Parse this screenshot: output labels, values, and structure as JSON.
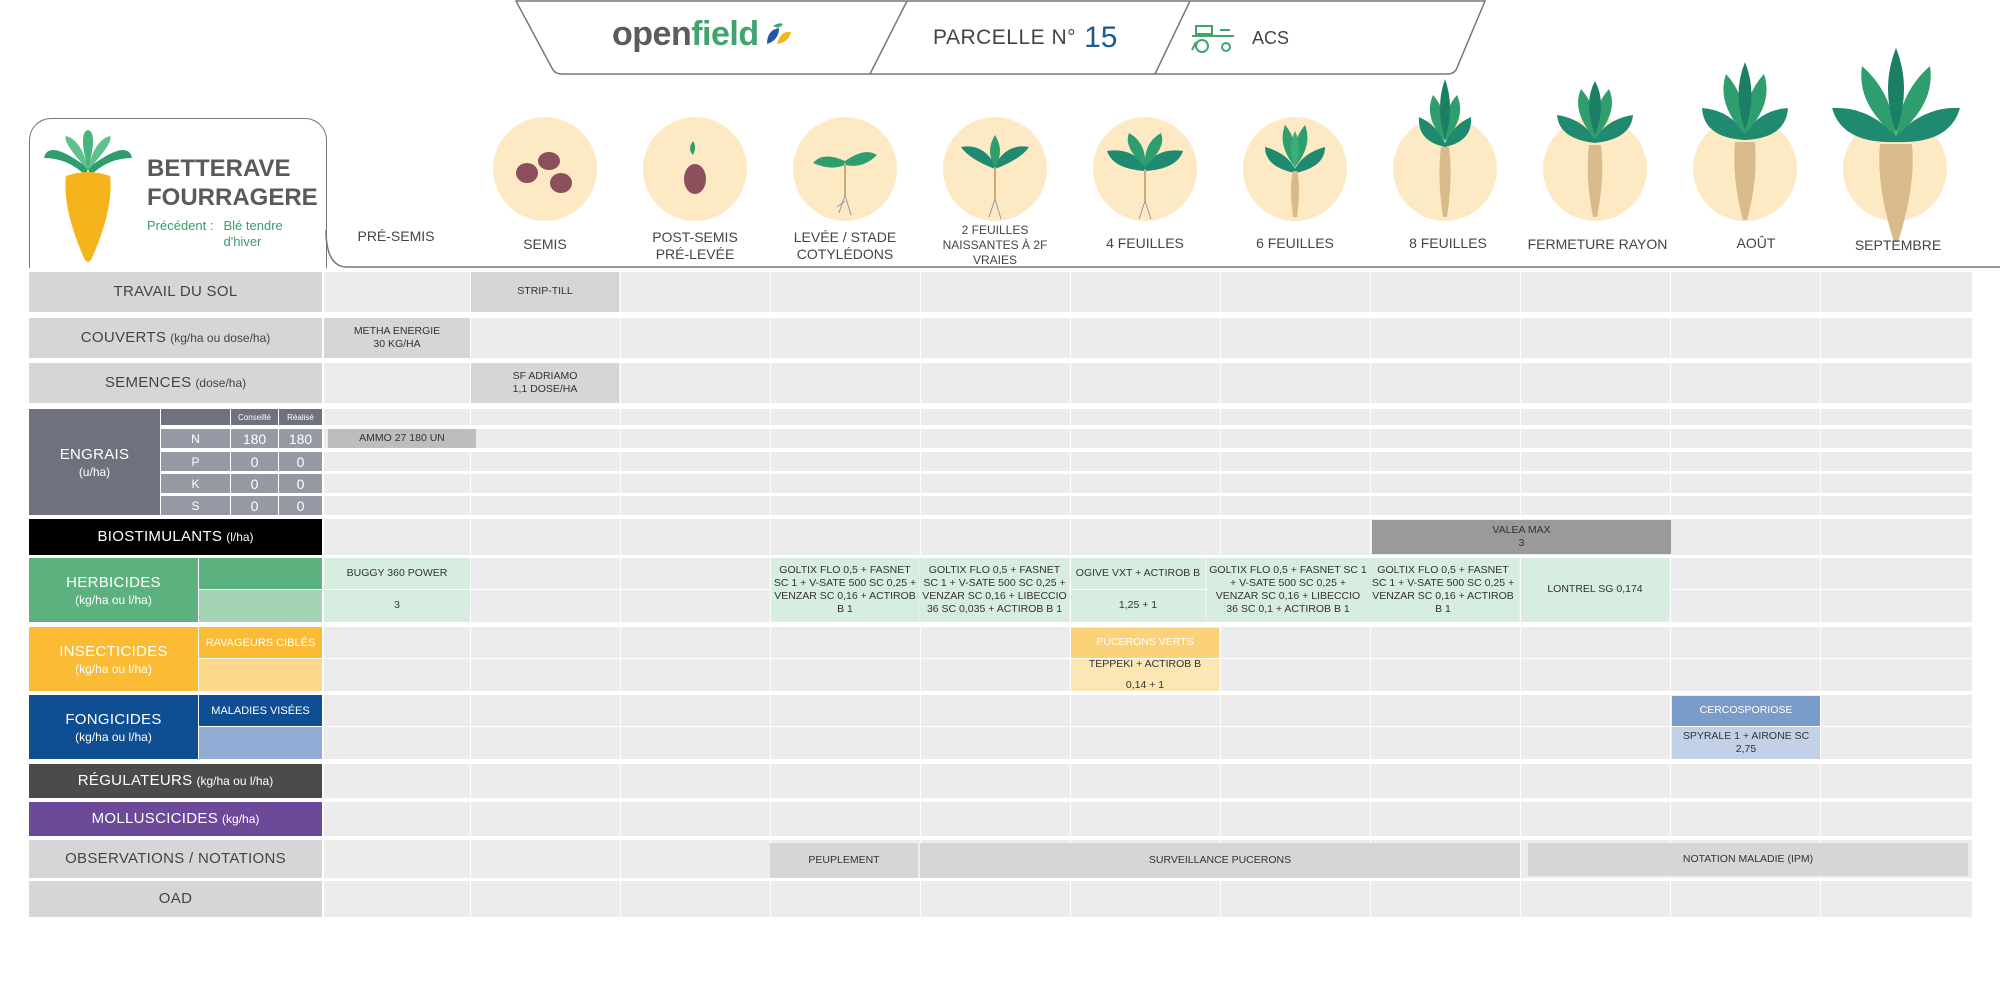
{
  "header": {
    "brand_open": "open",
    "brand_field": "field",
    "parcel_label": "PARCELLE N°",
    "parcel_number": "15",
    "system": "ACS"
  },
  "crop": {
    "name_line1": "BETTERAVE",
    "name_line2": "FOURRAGERE",
    "precedent_label": "Précédent :",
    "precedent_value": "Blé tendre d'hiver"
  },
  "stages": [
    {
      "label": "PRÉ-SEMIS"
    },
    {
      "label": "SEMIS"
    },
    {
      "label": "POST-SEMIS PRÉ-LEVÉE"
    },
    {
      "label": "LEVÉE / STADE COTYLÉDONS"
    },
    {
      "label": "2 FEUILLES NAISSANTES À 2F VRAIES"
    },
    {
      "label": "4 FEUILLES"
    },
    {
      "label": "6 FEUILLES"
    },
    {
      "label": "8 FEUILLES"
    },
    {
      "label": "FERMETURE RAYON"
    },
    {
      "label": "AOÛT"
    },
    {
      "label": "SEPTEMBRE"
    }
  ],
  "rows": {
    "travail": {
      "label": "TRAVAIL DU SOL"
    },
    "couverts": {
      "label": "COUVERTS",
      "unit": "(kg/ha ou dose/ha)"
    },
    "semences": {
      "label": "SEMENCES",
      "unit": "(dose/ha)"
    },
    "engrais": {
      "label": "ENGRAIS",
      "unit": "(u/ha)",
      "col_conseille": "Conseillé",
      "col_realise": "Réalisé",
      "nutrients": [
        {
          "name": "N",
          "conseille": "180",
          "realise": "180"
        },
        {
          "name": "P",
          "conseille": "0",
          "realise": "0"
        },
        {
          "name": "K",
          "conseille": "0",
          "realise": "0"
        },
        {
          "name": "S",
          "conseille": "0",
          "realise": "0"
        }
      ]
    },
    "biostim": {
      "label": "BIOSTIMULANTS",
      "unit": "(l/ha)"
    },
    "herbicides": {
      "label": "HERBICIDES",
      "unit": "(kg/ha ou l/ha)"
    },
    "insecticides": {
      "label": "INSECTICIDES",
      "unit": "(kg/ha ou l/ha)",
      "sub": "RAVAGEURS CIBLÉS"
    },
    "fongicides": {
      "label": "FONGICIDES",
      "unit": "(kg/ha ou l/ha)",
      "sub": "MALADIES VISÉES"
    },
    "regulateurs": {
      "label": "RÉGULATEURS",
      "unit": "(kg/ha ou l/ha)"
    },
    "molluscicides": {
      "label": "MOLLUSCICIDES",
      "unit": "(kg/ha)"
    },
    "observations": {
      "label": "OBSERVATIONS / NOTATIONS"
    },
    "oad": {
      "label": "OAD"
    }
  },
  "entries": {
    "strip_till": "STRIP-TILL",
    "couvert_line1": "METHA ENERGIE",
    "couvert_line2": "30 KG/HA",
    "semence_line1": "SF ADRIAMO",
    "semence_line2": "1,1 DOSE/HA",
    "ammo": "AMMO 27 180 UN",
    "valea_line1": "VALEA MAX",
    "valea_line2": "3",
    "buggy_product": "BUGGY 360 POWER",
    "buggy_dose": "3",
    "herb_levee": "GOLTIX FLO 0,5 + FASNET SC 1 + V-SATE 500 SC 0,25 + VENZAR SC 0,16 + ACTIROB B 1",
    "herb_2f": "GOLTIX FLO 0,5 + FASNET SC 1 + V-SATE 500 SC 0,25 + VENZAR SC 0,16 + LIBECCIO 36 SC 0,035 + ACTIROB B 1",
    "herb_4f_product": "OGIVE VXT + ACTIROB B",
    "herb_4f_dose": "1,25 + 1",
    "herb_6f": "GOLTIX FLO 0,5 + FASNET SC 1 + V-SATE 500 SC 0,25 + VENZAR SC 0,16 + LIBECCIO 36 SC 0,1 + ACTIROB B 1",
    "herb_8f": "GOLTIX FLO 0,5 + FASNET SC 1 + V-SATE 500 SC 0,25 + VENZAR SC 0,16 + ACTIROB B 1",
    "herb_fermeture": "LONTREL SG 0,174",
    "insect_target": "PUCERONS VERTS",
    "insect_product": "TEPPEKI + ACTIROB B",
    "insect_dose": "0,14 + 1",
    "fong_target": "CERCOSPORIOSE",
    "fong_product": "SPYRALE 1 + AIRONE SC 2,75",
    "obs_peuplement": "PEUPLEMENT",
    "obs_pucerons": "SURVEILLANCE PUCERONS",
    "obs_maladie": "NOTATION MALADIE (IPM)"
  },
  "colors": {
    "herbicide": "#5bb27f",
    "herbicide_light": "#a3d4b4",
    "herbicide_cell": "#d6eddf",
    "insecticide": "#fbbb35",
    "insecticide_light": "#fcd98a",
    "insecticide_cell": "#fbe6b4",
    "fongicide": "#0e4e93",
    "fongicide_light": "#93acd6",
    "fongicide_cell": "#c3d1e8",
    "engrais": "#6f717e",
    "biostim": "#000000",
    "regulateur": "#4b4b4b",
    "molluscicide": "#6b4a9a",
    "gray_label": "#d6d6d6",
    "row": "#ececec",
    "accent_green": "#3a9b6a",
    "number_blue": "#1c5a8c"
  }
}
